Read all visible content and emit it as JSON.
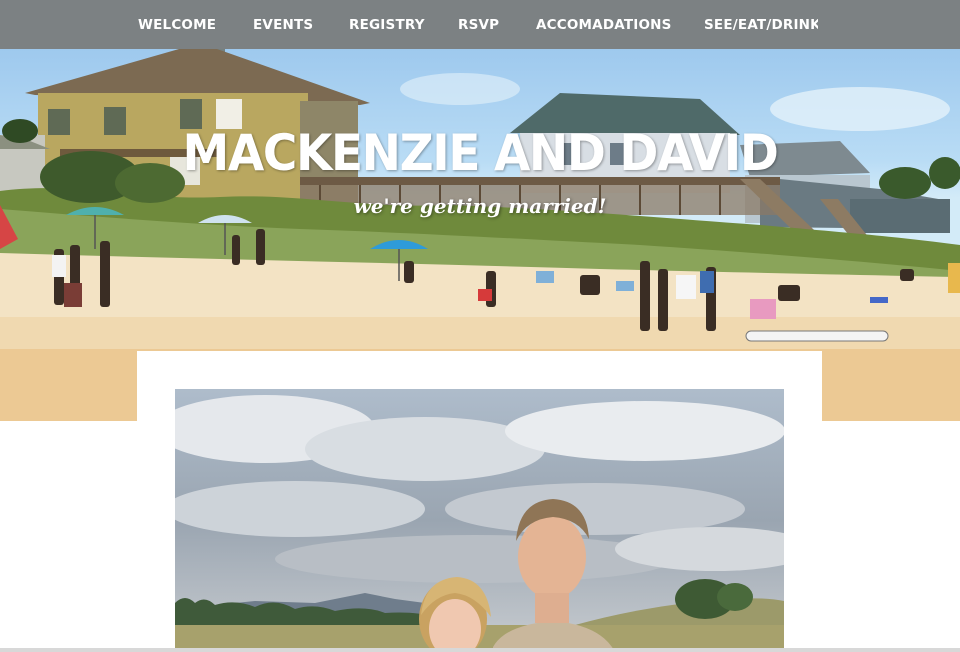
{
  "nav": {
    "items": [
      {
        "label": "WELCOME"
      },
      {
        "label": "EVENTS"
      },
      {
        "label": "REGISTRY"
      },
      {
        "label": "RSVP"
      },
      {
        "label": "ACCOMADATIONS"
      },
      {
        "label": "SEE/EAT/DRINK"
      }
    ]
  },
  "hero": {
    "title": "MACKENZIE AND DAVID",
    "subtitle": "we're getting married!"
  },
  "colors": {
    "nav_bg": "#7c8183",
    "text": "#ffffff",
    "sand": "#f3e3c4"
  }
}
